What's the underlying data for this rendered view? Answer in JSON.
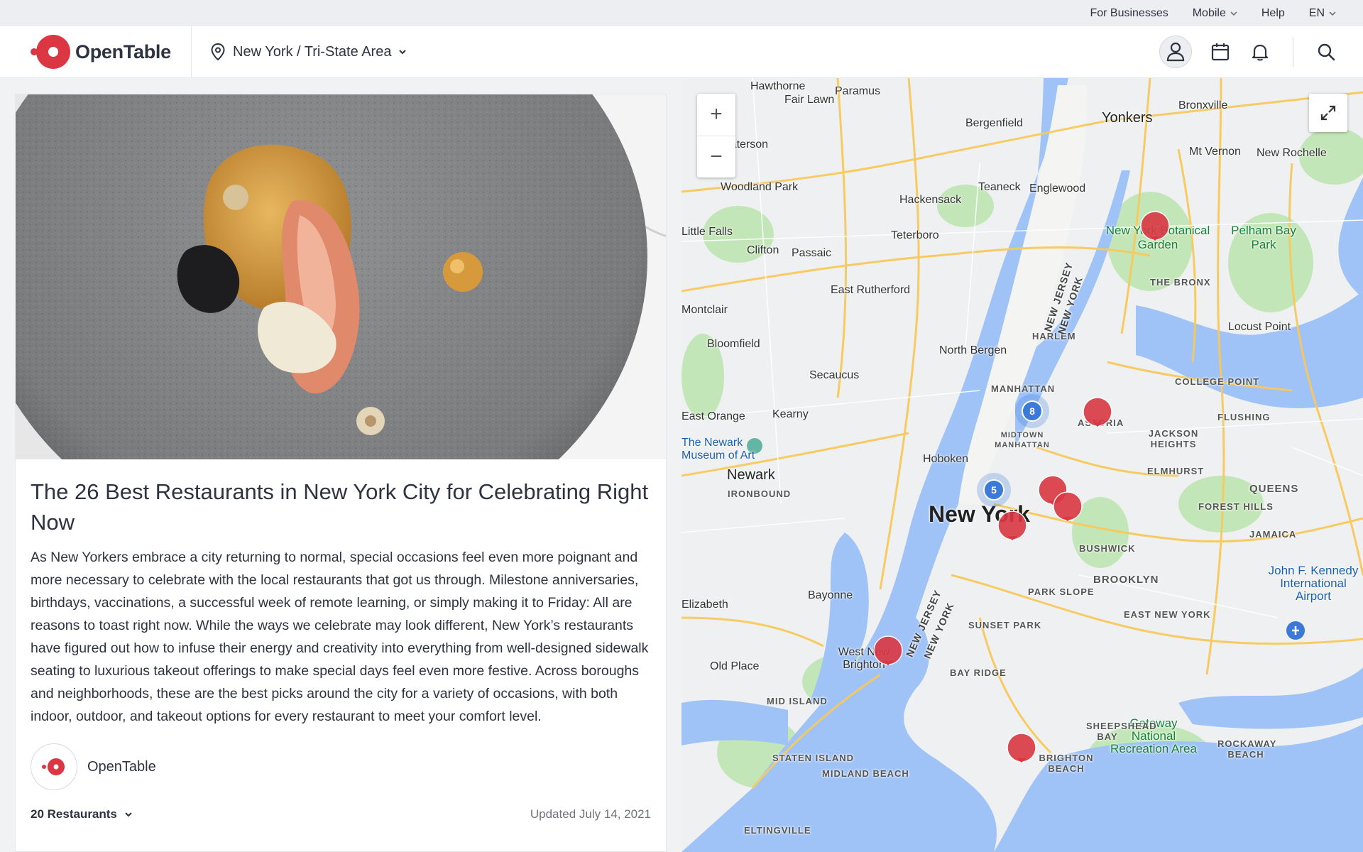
{
  "utility_bar": {
    "for_businesses": "For Businesses",
    "mobile": "Mobile",
    "help": "Help",
    "language": "EN"
  },
  "header": {
    "brand": "OpenTable",
    "location": "New York / Tri-State Area"
  },
  "article": {
    "title": "The 26 Best Restaurants in New York City for Celebrating Right Now",
    "body": "As New Yorkers embrace a city returning to normal, special occasions feel even more poignant and more necessary to celebrate with the local restaurants that got us through. Milestone anniversaries, birthdays, vaccinations, a successful week of remote learning, or simply making it to Friday: All are reasons to toast right now. While the ways we celebrate may look different, New York’s restaurants have figured out how to infuse their energy and creativity into everything from well-designed sidewalk seating to luxurious takeout offerings to make special days feel even more festive. Across boroughs and neighborhoods, these are the best picks around the city for a variety of occasions, with both indoor, outdoor, and takeout options for every restaurant to meet your comfort level.",
    "author": "OpenTable",
    "restaurant_count": "20 Restaurants",
    "updated": "Updated July 14, 2021"
  },
  "map": {
    "zoom_in": "+",
    "zoom_out": "−",
    "clusters": [
      {
        "name": "cluster-midtown",
        "count": "8"
      },
      {
        "name": "cluster-downtown",
        "count": "5"
      }
    ],
    "labels": {
      "yonkers": "Yonkers",
      "new_york": "New York",
      "newark": "Newark",
      "manhattan": "MANHATTAN",
      "brooklyn": "BROOKLYN",
      "queens": "QUEENS",
      "the_bronx": "THE BRONX",
      "bronxville": "Bronxville",
      "mt_vernon": "Mt Vernon",
      "new_rochelle": "New Rochelle",
      "hoboken": "Hoboken",
      "secaucus": "Secaucus",
      "north_bergen": "North Bergen",
      "bayonne": "Bayonne",
      "kearny": "Kearny",
      "harlem": "HARLEM",
      "midtown": "MIDTOWN MANHATTAN",
      "astoria": "ASTORIA",
      "flushing": "FLUSHING",
      "jamaica": "JAMAICA",
      "staten_island": "STATEN ISLAND",
      "bay_ridge": "BAY RIDGE",
      "park_slope": "PARK SLOPE",
      "bushwick": "BUSHWICK",
      "sunset_park": "SUNSET PARK",
      "elmhurst": "ELMHURST",
      "forest_hills": "FOREST HILLS",
      "east_new_york": "EAST NEW YORK",
      "college_point": "COLLEGE POINT",
      "jackson_heights": "JACKSON HEIGHTS",
      "jfk": "John F. Kennedy International Airport",
      "gateway": "Gateway National Recreation Area",
      "botanical": "New York Botanical Garden",
      "pelham": "Pelham Bay Park",
      "west_new_brighton": "West New Brighton",
      "bergenfield": "Bergenfield",
      "teaneck": "Teaneck",
      "englewood": "Englewood",
      "hackensack": "Hackensack",
      "teterboro": "Teterboro",
      "passaic": "Passaic",
      "clifton": "Clifton",
      "east_rutherford": "East Rutherford",
      "bloomfield": "Bloomfield",
      "paramus": "Paramus",
      "hawthorne": "Hawthorne",
      "fair_lawn": "Fair Lawn",
      "woodland_park": "Woodland Park",
      "locust_point": "Locust Point",
      "elizabeth": "Elizabeth",
      "old_place": "Old Place",
      "east_orange": "East Orange",
      "montclair": "Montclair",
      "little_falls": "Little Falls",
      "paterson": "Paterson",
      "ironbound": "IRONBOUND",
      "newark_museum": "The Newark Museum of Art",
      "mid_island": "MID ISLAND",
      "midland_beach": "MIDLAND BEACH",
      "eltingville": "ELTINGVILLE",
      "sheepshead_bay": "SHEEPSHEAD BAY",
      "brighton_beach": "BRIGHTON BEACH",
      "rockaway_beach": "ROCKAWAY BEACH",
      "new_jersey_1": "NEW JERSEY",
      "new_york_state_1": "NEW YORK",
      "new_jersey_2": "NEW JERSEY",
      "new_york_state_2": "NEW YORK"
    }
  },
  "colors": {
    "brand_red": "#da3743",
    "water": "#9fc3f7",
    "park": "#c3e6b8",
    "cluster_blue": "#3b7ad9"
  }
}
